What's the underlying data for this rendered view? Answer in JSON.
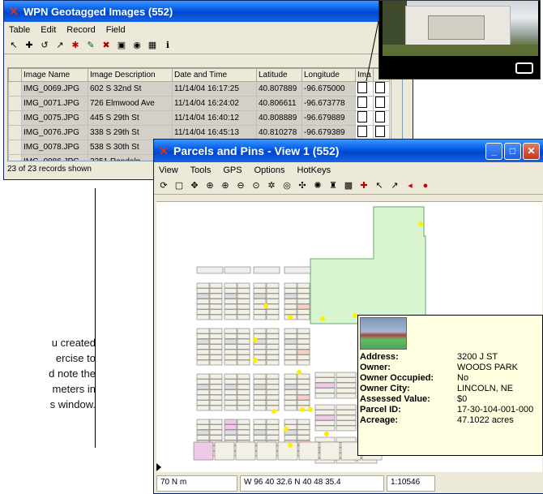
{
  "wpn_window": {
    "title": "WPN Geotagged Images (552)",
    "menu": [
      "Table",
      "Edit",
      "Record",
      "Field"
    ],
    "columns": [
      "Image Name",
      "Image Description",
      "Date and Time",
      "Latitude",
      "Longitude",
      "Ima"
    ],
    "rows": [
      {
        "name": "IMG_0069.JPG",
        "desc": "602 S 32nd St",
        "date": "11/14/04 16:17:25",
        "lat": "40.807889",
        "lon": "-96.675000"
      },
      {
        "name": "IMG_0071.JPG",
        "desc": "726 Elmwood Ave",
        "date": "11/14/04 16:24:02",
        "lat": "40.806611",
        "lon": "-96.673778"
      },
      {
        "name": "IMG_0075.JPG",
        "desc": "445 S 29th St",
        "date": "11/14/04 16:40:12",
        "lat": "40.808889",
        "lon": "-96.679889"
      },
      {
        "name": "IMG_0076.JPG",
        "desc": "338 S 29th St",
        "date": "11/14/04 16:45:13",
        "lat": "40.810278",
        "lon": "-96.679389"
      },
      {
        "name": "IMG_0078.JPG",
        "desc": "538 S 30th St",
        "date": "",
        "lat": "",
        "lon": ""
      },
      {
        "name": "IMG_0086.JPG",
        "desc": "3251 Randolp",
        "date": "",
        "lat": "",
        "lon": ""
      }
    ],
    "status": "23 of 23 records shown"
  },
  "side_text": [
    "u created",
    "ercise to",
    "d note the",
    "meters in",
    "s window."
  ],
  "parcels_window": {
    "title": "Parcels and Pins - View 1 (552)",
    "menu": [
      "View",
      "Tools",
      "GPS",
      "Options",
      "HotKeys"
    ],
    "status": {
      "scale": "70 N m",
      "coords": "W 96 40 32.6  N 40 48 35.4",
      "ratio": "1:10546"
    }
  },
  "card": {
    "rows": [
      {
        "k": "Address:",
        "v": "3200  J ST"
      },
      {
        "k": "Owner:",
        "v": "WOODS PARK"
      },
      {
        "k": "Owner Occupied:",
        "v": "No"
      },
      {
        "k": "Owner City:",
        "v": "LINCOLN, NE"
      },
      {
        "k": "Assessed Value:",
        "v": "$0"
      },
      {
        "k": "Parcel ID:",
        "v": "17-30-104-001-000"
      },
      {
        "k": "Acreage:",
        "v": "47.1022 acres"
      }
    ]
  },
  "colors": {
    "title_blue": "#0058e6",
    "parcel_green": "#d9f5d0",
    "pin_yellow": "#ffee00",
    "parcel_pink": "#f0c8e8",
    "card_bg": "#ffffe1"
  },
  "icons": [
    "app-icon",
    "minimize-icon",
    "maximize-icon",
    "close-icon",
    "zoom-in-icon",
    "zoom-out-icon",
    "pan-icon"
  ]
}
